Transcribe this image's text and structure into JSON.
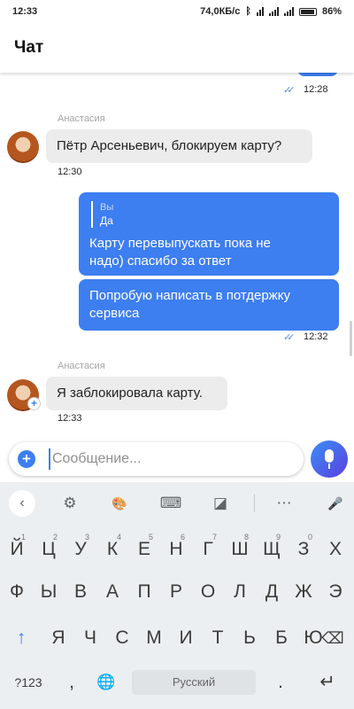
{
  "status_bar": {
    "time": "12:33",
    "net_speed": "74,0КБ/с",
    "battery": "86%"
  },
  "header": {
    "title": "Чат"
  },
  "chat": {
    "out1": {
      "time": "12:28"
    },
    "in1": {
      "sender": "Анастасия",
      "text": "Пётр Арсеньевич, блокируем карту?",
      "time": "12:30"
    },
    "out2": {
      "reply_name": "Вы",
      "reply_text": "Да",
      "text_line1": "Карту перевыпускать пока не",
      "text_line2": "надо) спасибо за ответ",
      "text2_line1": "Попробую написать в потдержку",
      "text2_line2": "сервиса",
      "time": "12:32"
    },
    "in2": {
      "sender": "Анастасия",
      "text": "Я заблокировала карту.",
      "time": "12:33"
    }
  },
  "composer": {
    "placeholder": "Сообщение..."
  },
  "keyboard": {
    "row1": [
      "Й",
      "Ц",
      "У",
      "К",
      "Е",
      "Н",
      "Г",
      "Ш",
      "Щ",
      "З",
      "Х"
    ],
    "row1_hints": [
      "1",
      "2",
      "3",
      "4",
      "5",
      "6",
      "7",
      "8",
      "9",
      "0",
      ""
    ],
    "row2": [
      "Ф",
      "Ы",
      "В",
      "А",
      "П",
      "Р",
      "О",
      "Л",
      "Д",
      "Ж",
      "Э"
    ],
    "row3": [
      "Я",
      "Ч",
      "С",
      "М",
      "И",
      "Т",
      "Ь",
      "Б",
      "Ю"
    ],
    "symbols_key": "?123",
    "space_label": "Русский",
    "icons": {
      "shift": "↑",
      "backspace": "⌫",
      "enter": "↵",
      "globe": "🌐",
      "comma": ",",
      "period": ".",
      "settings": "⚙",
      "theme": "🎨",
      "keyboard": "⌨",
      "more": "⋯",
      "mic": "🎤",
      "back": "‹",
      "edit": "◪"
    }
  },
  "colors": {
    "accent": "#3d7ef0",
    "incoming_bubble": "#ececec",
    "keyboard_bg": "#eceff1"
  }
}
